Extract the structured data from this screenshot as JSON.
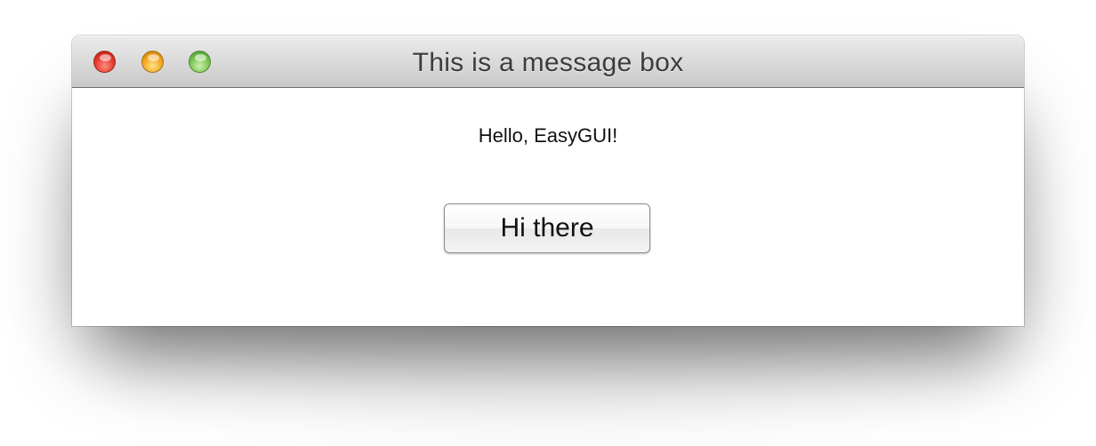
{
  "window": {
    "title": "This is a message box",
    "controls": {
      "close": {
        "icon": "close-dot-icon",
        "color": "#e4372b"
      },
      "minimize": {
        "icon": "minimize-dot-icon",
        "color": "#f2a51a"
      },
      "zoom": {
        "icon": "zoom-dot-icon",
        "color": "#7ac353"
      }
    }
  },
  "dialog": {
    "message": "Hello, EasyGUI!",
    "button_label": "Hi there"
  }
}
